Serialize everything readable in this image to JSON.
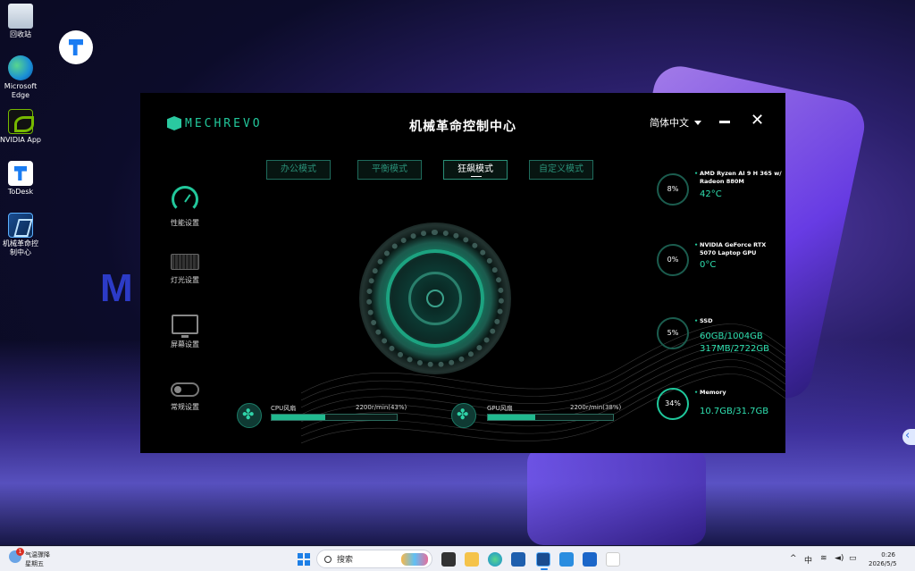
{
  "desktop": {
    "icons": [
      {
        "label": "回收站"
      },
      {
        "label": "Microsoft Edge"
      },
      {
        "label": "NVIDIA App"
      },
      {
        "label": "ToDesk"
      },
      {
        "label": "机械革命控制中心"
      }
    ],
    "wallpaper_text": "M"
  },
  "app": {
    "logo_text": "MECHREVO",
    "title": "机械革命控制中心",
    "language": "简体中文",
    "modes": [
      {
        "label": "办公模式",
        "active": false
      },
      {
        "label": "平衡模式",
        "active": false
      },
      {
        "label": "狂飙模式",
        "active": true
      },
      {
        "label": "自定义模式",
        "active": false
      }
    ],
    "sidebar": [
      {
        "label": "性能设置",
        "icon": "gauge-icon"
      },
      {
        "label": "灯光设置",
        "icon": "keyboard-icon"
      },
      {
        "label": "屏幕设置",
        "icon": "monitor-icon"
      },
      {
        "label": "常规设置",
        "icon": "toggle-icon"
      }
    ],
    "fans": [
      {
        "label": "CPU风扇",
        "rpm": "2200r/min(43%)",
        "percent": 43
      },
      {
        "label": "GPU风扇",
        "rpm": "2200r/min(38%)",
        "percent": 38
      }
    ],
    "stats": [
      {
        "name": "AMD Ryzen AI 9 H 365 w/ Radeon 880M",
        "usage": "8%",
        "value": "42°C"
      },
      {
        "name": "NVIDIA GeForce RTX 5070 Laptop GPU",
        "usage": "0%",
        "value": "0°C"
      },
      {
        "name": "SSD",
        "usage": "5%",
        "value": "60GB/1004GB",
        "value2": "317MB/2722GB"
      },
      {
        "name": "Memory",
        "usage": "34%",
        "value": "10.7GB/31.7GB"
      }
    ],
    "colors": {
      "accent": "#22c79b",
      "background": "#000000"
    }
  },
  "taskbar": {
    "weather_line1": "气温骤降",
    "weather_line2": "星期五",
    "weather_badge": "1",
    "search_placeholder": "搜索",
    "ime": "中",
    "time": "0:26",
    "date": "2026/5/5"
  }
}
